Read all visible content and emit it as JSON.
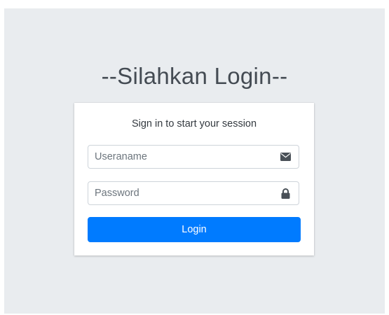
{
  "page": {
    "title": "--Silahkan Login--"
  },
  "login_box": {
    "message": "Sign in to start your session",
    "username": {
      "placeholder": "Useraname",
      "value": "",
      "icon": "envelope-icon"
    },
    "password": {
      "placeholder": "Password",
      "value": "",
      "icon": "lock-icon"
    },
    "submit_label": "Login"
  },
  "colors": {
    "background": "#e9ecef",
    "primary": "#007bff",
    "title_text": "#444b53"
  }
}
